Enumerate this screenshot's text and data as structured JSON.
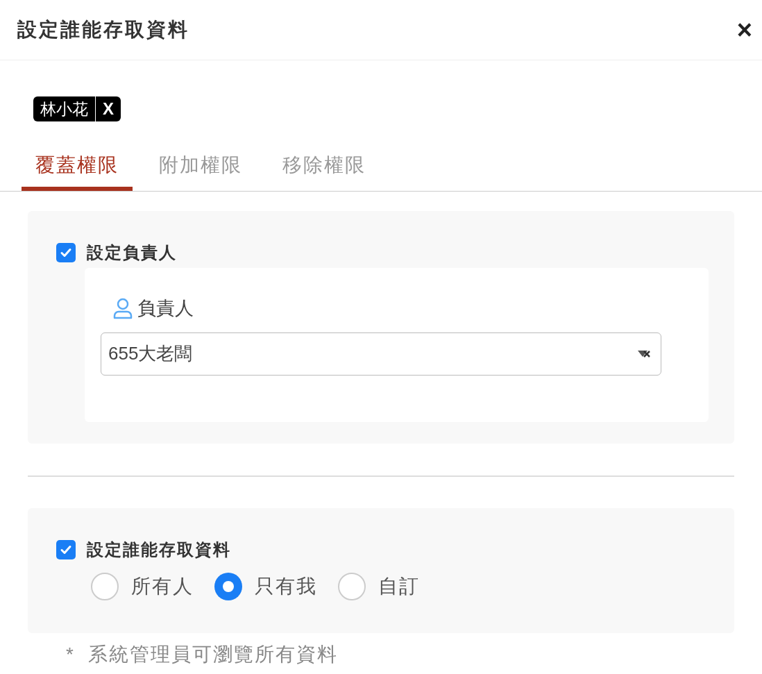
{
  "dialog": {
    "title": "設定誰能存取資料",
    "close": "×"
  },
  "tags": [
    {
      "label": "林小花",
      "remove": "X"
    }
  ],
  "tabs": [
    {
      "label": "覆蓋權限",
      "selected": true
    },
    {
      "label": "附加權限",
      "selected": false
    },
    {
      "label": "移除權限",
      "selected": false
    }
  ],
  "owner_section": {
    "checkbox": {
      "label": "設定負責人",
      "checked": true
    },
    "field_label": "負責人",
    "value": "655大老闆"
  },
  "access_section": {
    "checkbox": {
      "label": "設定誰能存取資料",
      "checked": true
    },
    "options": [
      {
        "label": "所有人",
        "selected": false
      },
      {
        "label": "只有我",
        "selected": true
      },
      {
        "label": "自訂",
        "selected": false
      }
    ]
  },
  "footnote": "*  系統管理員可瀏覽所有資料"
}
